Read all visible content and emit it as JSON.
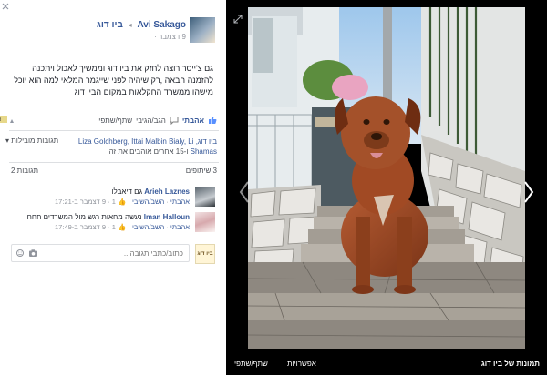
{
  "post": {
    "author": "Avi Sakago",
    "page": "ביו דוג",
    "timestamp": "9 דצמבר",
    "text": "גם צ'ייסר רוצה לחזק את ביו דוג וממשיך לאכול ויתכנה להזמנה הבאה ,רק שיהיה לפני שייגמר המלאי למה הוא יוכל מישהו ממשרד החקלאות במקום הביו דוג"
  },
  "actions": {
    "like": "אהבתי",
    "comment": "הגב/הגיבי",
    "share": "שתף/שתפי"
  },
  "tagged": {
    "line1": "ביו דוג, Liza Golchberg, Ittai Malbin Bialy, Li",
    "line2_prefix": "Shamas",
    "line2_suffix": "ו-15 אחרים אוהבים את זה.",
    "suggest_tags": "תגובות מובילות"
  },
  "counts": {
    "comments": "3 שיתופים",
    "tags": "2 תגובות"
  },
  "comments": [
    {
      "author": "Arieh Laznes",
      "text": "גם דיאבלו",
      "like": "אהבתי",
      "reply": "השב/השיבי",
      "likes": "1",
      "time": "9 דצמבר ב-17:21"
    },
    {
      "author": "Iman Halloun",
      "text": "נעשה מחאות רגש מול המשרדים חחח",
      "like": "אהבתי",
      "reply": "השב/השיבי",
      "likes": "1",
      "time": "9 דצמבר ב-17:49"
    }
  ],
  "comment_input": {
    "placeholder": "כתוב/כתבי תגובה...",
    "my_avatar_label": "ביו דוג"
  },
  "bottom_bar": {
    "album": "תמונות של ביו דוג",
    "options": "אפשרויות",
    "share": "שתף/שתפי"
  },
  "colors": {
    "link": "#365899",
    "muted": "#90949c",
    "panel_bg": "#ffffff",
    "viewer_bg": "#000000"
  },
  "icons": {
    "close": "close-icon",
    "expand": "expand-icon",
    "like": "thumbs-up-icon",
    "comment": "comment-icon",
    "camera": "camera-icon",
    "emoji": "emoji-icon",
    "prev": "chevron-left-icon",
    "next": "chevron-right-icon"
  }
}
